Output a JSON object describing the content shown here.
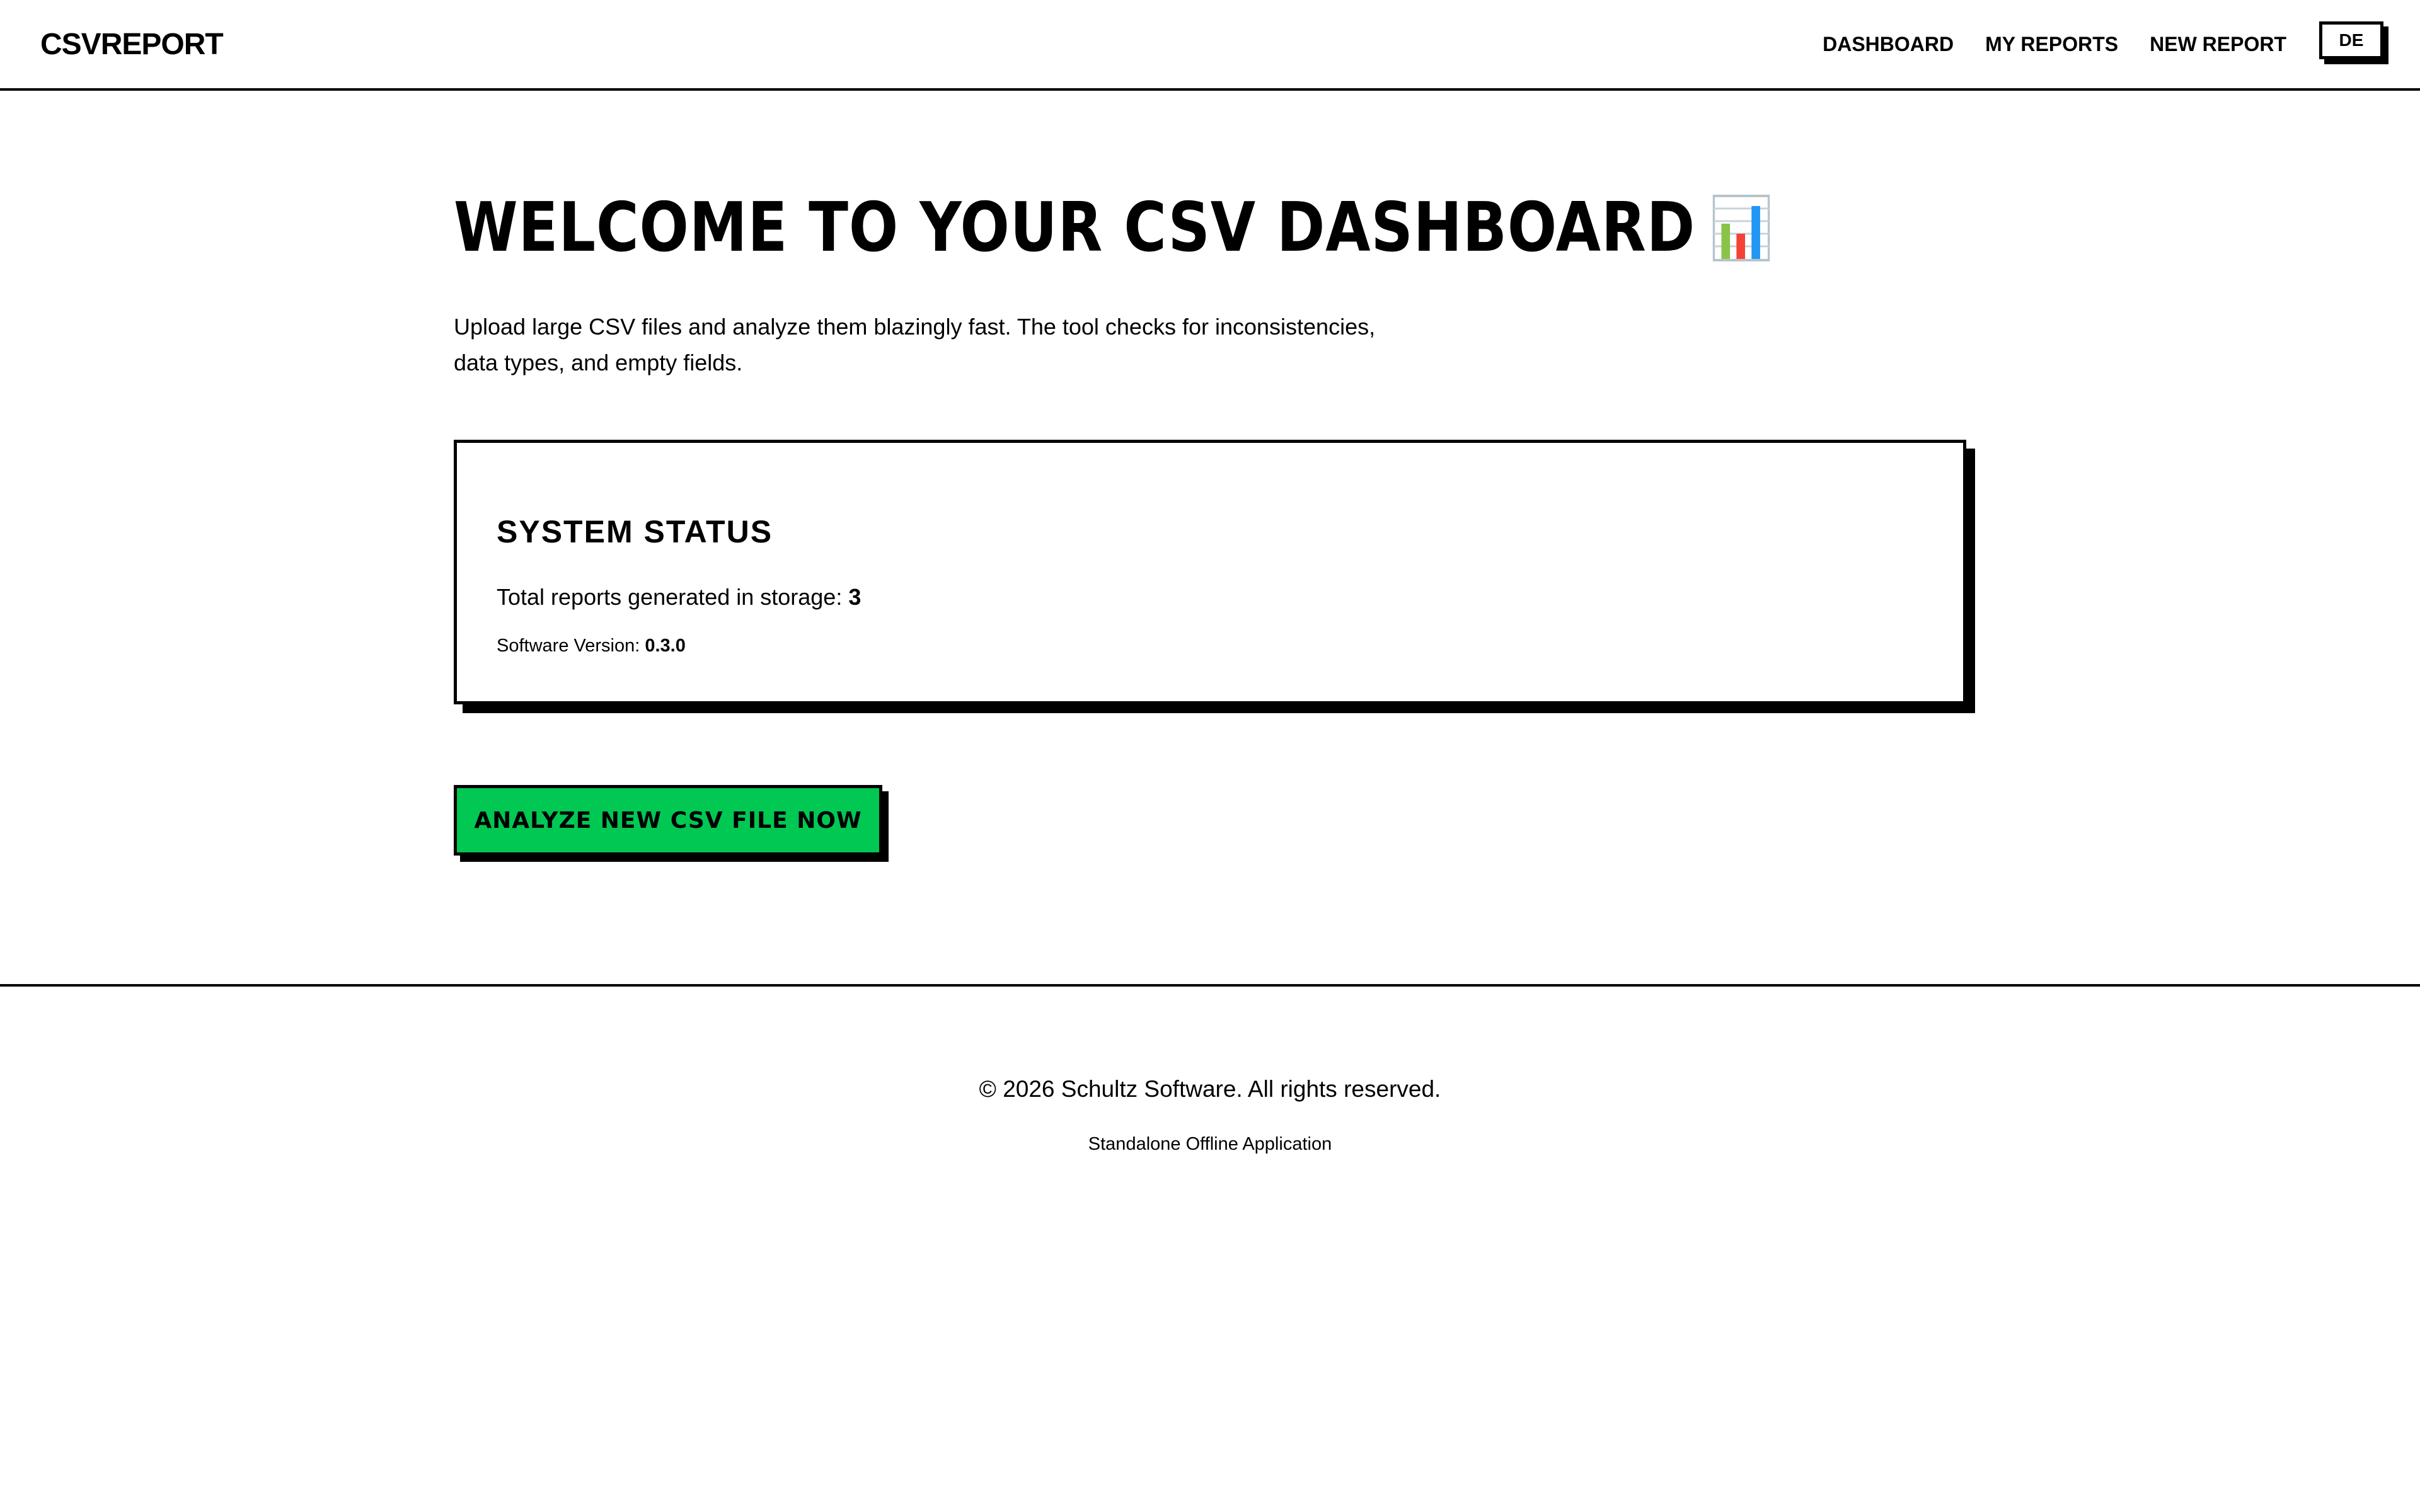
{
  "header": {
    "brand": "CSVREPORT",
    "nav": [
      {
        "label": "DASHBOARD"
      },
      {
        "label": "MY REPORTS"
      },
      {
        "label": "NEW REPORT"
      }
    ],
    "language_button": "DE"
  },
  "main": {
    "title": "WELCOME TO YOUR CSV DASHBOARD",
    "title_icon": "bar-chart-icon",
    "intro_line1": "Upload large CSV files and analyze them blazingly fast. The tool checks for inconsistencies,",
    "intro_line2": "data types, and empty fields.",
    "status": {
      "title": "SYSTEM STATUS",
      "reports_label": "Total reports generated in storage: ",
      "reports_count": "3",
      "version_label": "Software Version: ",
      "version_value": "0.3.0"
    },
    "cta_label": "ANALYZE NEW CSV FILE NOW"
  },
  "footer": {
    "copyright": "© 2026 Schultz Software. All rights reserved.",
    "note": "Standalone Offline Application"
  },
  "colors": {
    "accent_green": "#00c853",
    "border": "#000000",
    "background": "#ffffff"
  }
}
